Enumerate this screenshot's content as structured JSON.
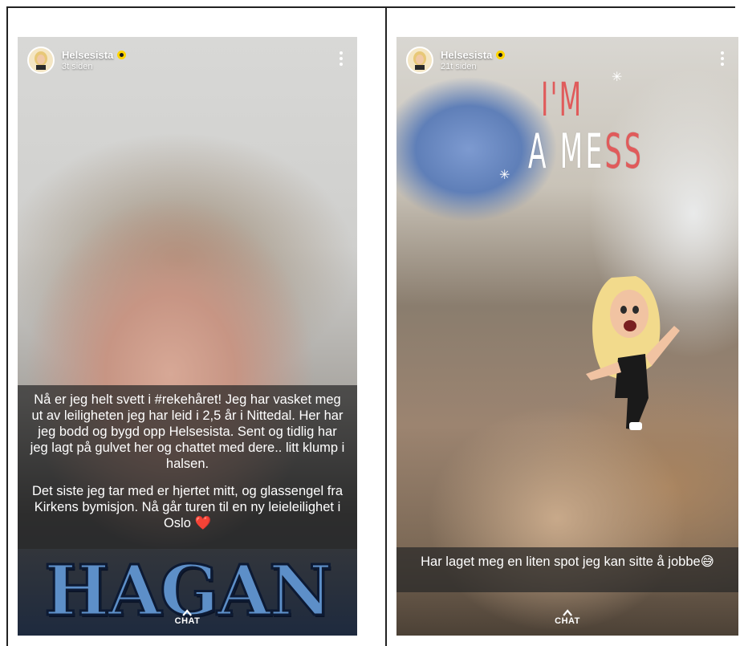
{
  "story_left": {
    "username": "Helsesista",
    "time": "3t siden",
    "caption_p1": "Nå er jeg helt svett i #rekehåret! Jeg har vasket meg ut av leiligheten jeg har leid i 2,5 år i Nittedal. Her har jeg bodd og bygd opp Helsesista. Sent og tidlig har jeg lagt på gulvet her og chattet med dere.. litt klump i halsen.",
    "caption_p2": "Det siste jeg tar med er hjertet mitt, og glassengel fra Kirkens bymisjon. Nå går turen til en ny leieleilighet i Oslo ❤️",
    "sticker_text": "HAGAN",
    "chat_label": "CHAT"
  },
  "story_right": {
    "username": "Helsesista",
    "time": "21t siden",
    "sticker_line1": "I'M",
    "sticker_line2_prefix": "A M",
    "sticker_line2_mid": "E",
    "sticker_line2_red": "SS",
    "caption": "Har laget meg en liten spot jeg kan sitte å jobbe😅",
    "chat_label": "CHAT"
  },
  "icons": {
    "menu": "more-vertical-icon",
    "badge": "verified-badge-icon",
    "chat": "chevron-up-icon"
  },
  "colors": {
    "badge": "#ffd400",
    "caption_bg": "rgba(40,40,40,0.72)",
    "sticker_red": "#e05b5b"
  }
}
